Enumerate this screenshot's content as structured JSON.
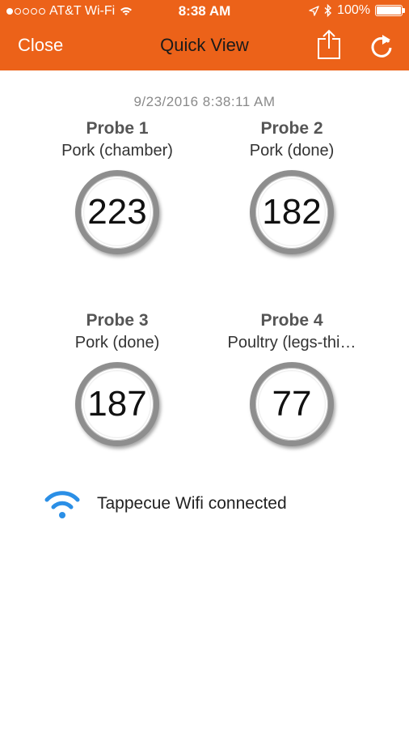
{
  "status_bar": {
    "carrier": "AT&T Wi-Fi",
    "time": "8:38 AM",
    "battery": "100%"
  },
  "nav": {
    "close_label": "Close",
    "title": "Quick View"
  },
  "timestamp": "9/23/2016 8:38:11 AM",
  "probes": [
    {
      "title": "Probe 1",
      "label": "Pork (chamber)",
      "value": "223"
    },
    {
      "title": "Probe 2",
      "label": "Pork (done)",
      "value": "182"
    },
    {
      "title": "Probe 3",
      "label": "Pork (done)",
      "value": "187"
    },
    {
      "title": "Probe 4",
      "label": "Poultry (legs-thi…",
      "value": "77"
    }
  ],
  "connection": {
    "label": "Tappecue Wifi connected",
    "icon": "wifi-icon",
    "icon_color": "#2b8fe6"
  },
  "colors": {
    "header": "#ec6219"
  }
}
